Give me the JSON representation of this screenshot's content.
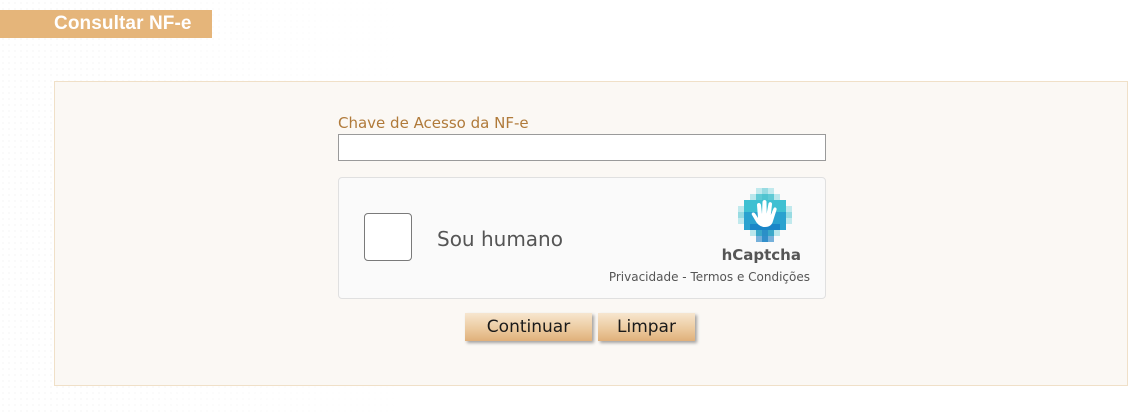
{
  "header": {
    "title": "Consultar NF-e"
  },
  "form": {
    "access_key_label": "Chave de Acesso da NF-e",
    "access_key_value": "",
    "access_key_placeholder": ""
  },
  "captcha": {
    "checkbox_label": "Sou humano",
    "brand": "hCaptcha",
    "privacy_link": "Privacidade",
    "separator": " - ",
    "terms_link": "Termos e Condições",
    "logo_icon": "hcaptcha-hand-icon",
    "checked": false
  },
  "buttons": {
    "continue_label": "Continuar",
    "clear_label": "Limpar"
  },
  "colors": {
    "title_bar": "#e5b57a",
    "label": "#b07a3a",
    "panel_bg": "#fbf8f4",
    "captcha_logo_light": "#7ed3dc",
    "captcha_logo_dark": "#0074bf"
  }
}
